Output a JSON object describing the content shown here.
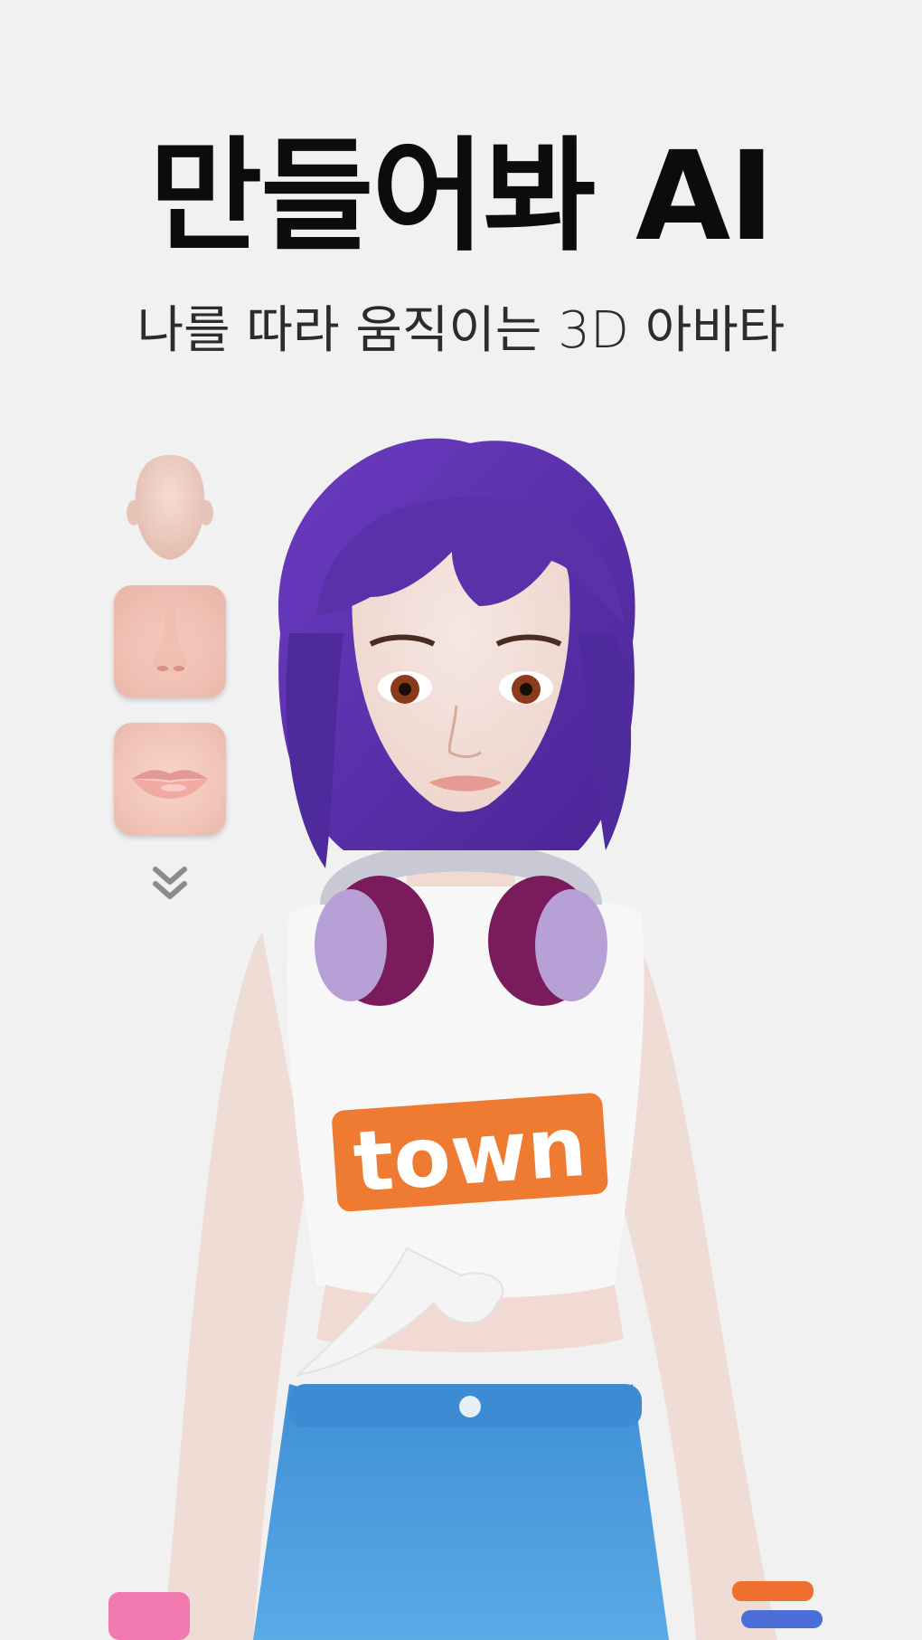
{
  "header": {
    "title": "만들어봐 AI",
    "subtitle": "나를 따라 움직이는 3D 아바타"
  },
  "parts_panel": {
    "items": [
      {
        "name": "face-shape",
        "icon": "head-icon"
      },
      {
        "name": "nose",
        "icon": "nose-icon"
      },
      {
        "name": "lips",
        "icon": "lips-icon"
      }
    ],
    "expand_icon": "chevron-double-down-icon"
  },
  "avatar": {
    "shirt_logo": "town",
    "colors": {
      "hair": "#5a31a8",
      "shirt": "#ffffff",
      "logo_bg": "#ef7b32",
      "jeans": "#4a9ad8",
      "headphones_cup": "#7a1b5c",
      "skin": "#f2ddd6"
    }
  }
}
